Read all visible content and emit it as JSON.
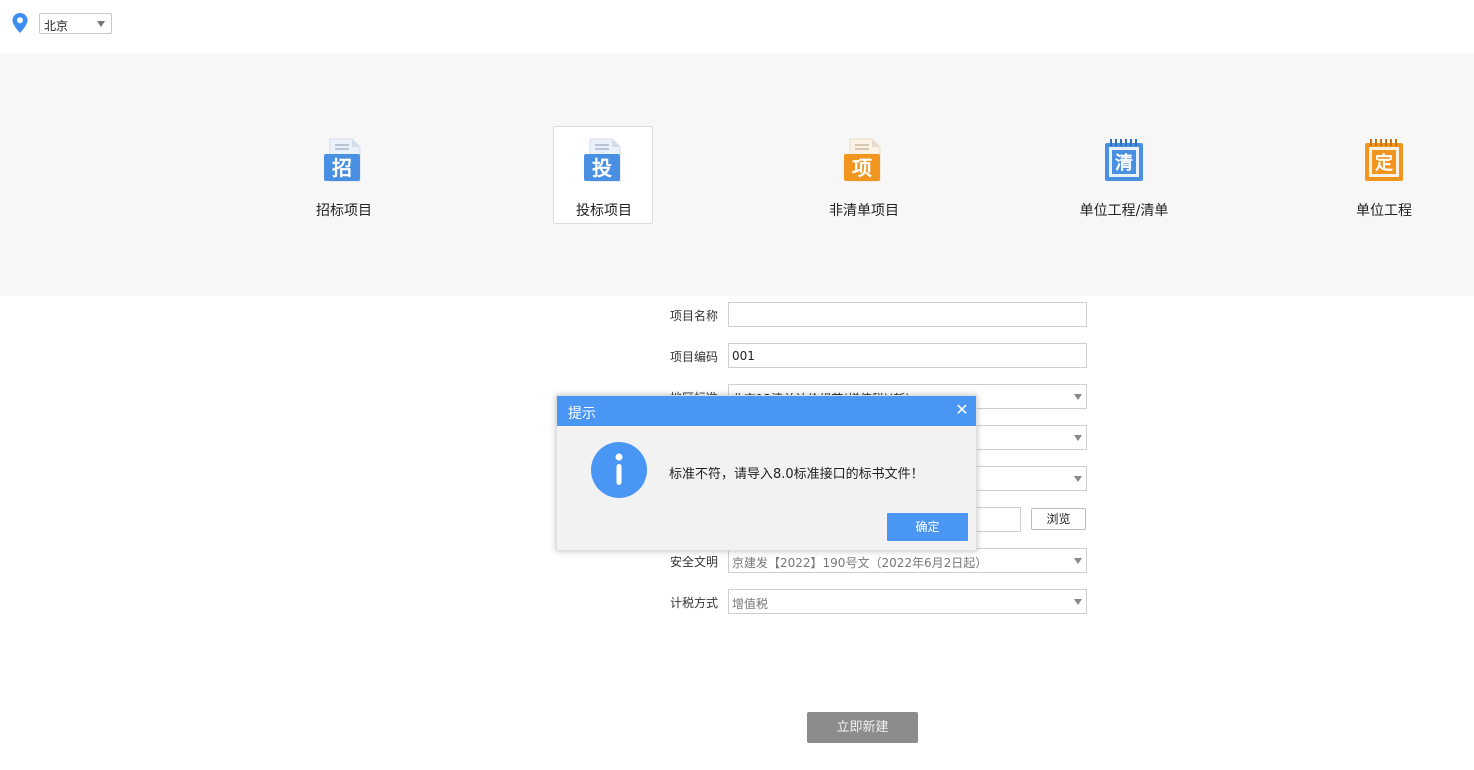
{
  "location": {
    "city": "北京"
  },
  "categories": [
    {
      "label": "招标项目",
      "glyph": "招",
      "color": "#4a90e2"
    },
    {
      "label": "投标项目",
      "glyph": "投",
      "color": "#4a90e2",
      "active": true
    },
    {
      "label": "非清单项目",
      "glyph": "项",
      "color": "#f0951e"
    },
    {
      "label": "单位工程/清单",
      "glyph": "清",
      "color": "#4a90e2"
    },
    {
      "label": "单位工程",
      "glyph": "定",
      "color": "#f0951e"
    }
  ],
  "form": {
    "project_name": {
      "label": "项目名称",
      "value": ""
    },
    "project_code": {
      "label": "项目编码",
      "value": "001"
    },
    "standard": {
      "label": "地区标准",
      "value": "北京12清单计价规范(增值税)(新)"
    },
    "safety": {
      "label": "安全文明",
      "value": "京建发【2022】190号文（2022年6月2日起）"
    },
    "tax": {
      "label": "计税方式",
      "value": "增值税"
    },
    "browse_label": "浏览",
    "create_label": "立即新建"
  },
  "dialog": {
    "title": "提示",
    "message": "标准不符，请导入8.0标准接口的标书文件！",
    "ok_label": "确定"
  },
  "colors": {
    "accent": "#4a96f5",
    "orange": "#f0951e"
  }
}
